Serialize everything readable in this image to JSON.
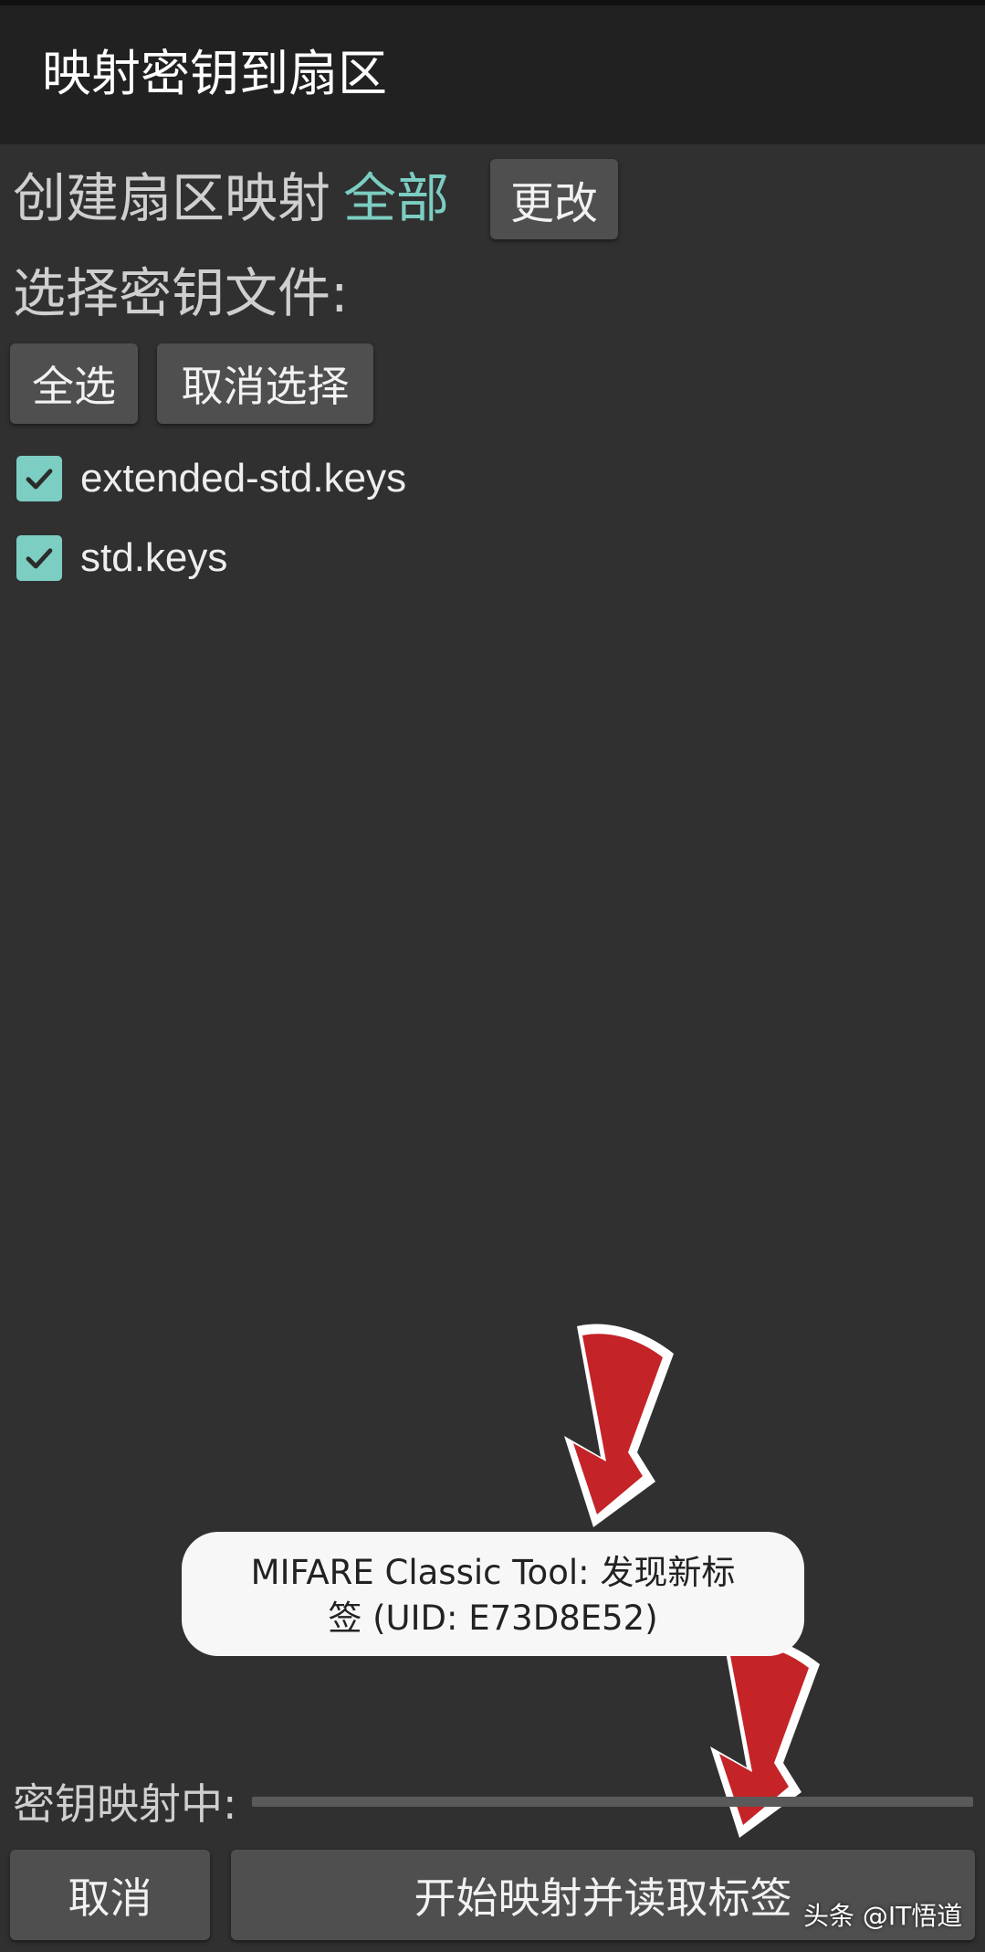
{
  "toolbar": {
    "title": "映射密钥到扇区"
  },
  "sector_map": {
    "label": "创建扇区映射",
    "value": "全部",
    "change_button": "更改"
  },
  "key_files": {
    "label": "选择密钥文件:",
    "select_all_button": "全选",
    "deselect_button": "取消选择",
    "items": [
      {
        "name": "extended-std.keys",
        "checked": true
      },
      {
        "name": "std.keys",
        "checked": true
      }
    ]
  },
  "toast": {
    "line1": "MIFARE Classic Tool: 发现新标",
    "line2": "签 (UID: E73D8E52)"
  },
  "progress": {
    "label": "密钥映射中:",
    "value": 0
  },
  "footer": {
    "cancel_button": "取消",
    "start_button": "开始映射并读取标签"
  },
  "watermark": {
    "text": "头条 @IT悟道"
  },
  "colors": {
    "accent": "#7ccdc2",
    "background": "#303030",
    "toolbar": "#212121",
    "button": "#4f4f4f",
    "arrow": "#c42327"
  },
  "icons": {
    "checkbox": "check-icon",
    "annotation": "arrow-down-icon"
  }
}
